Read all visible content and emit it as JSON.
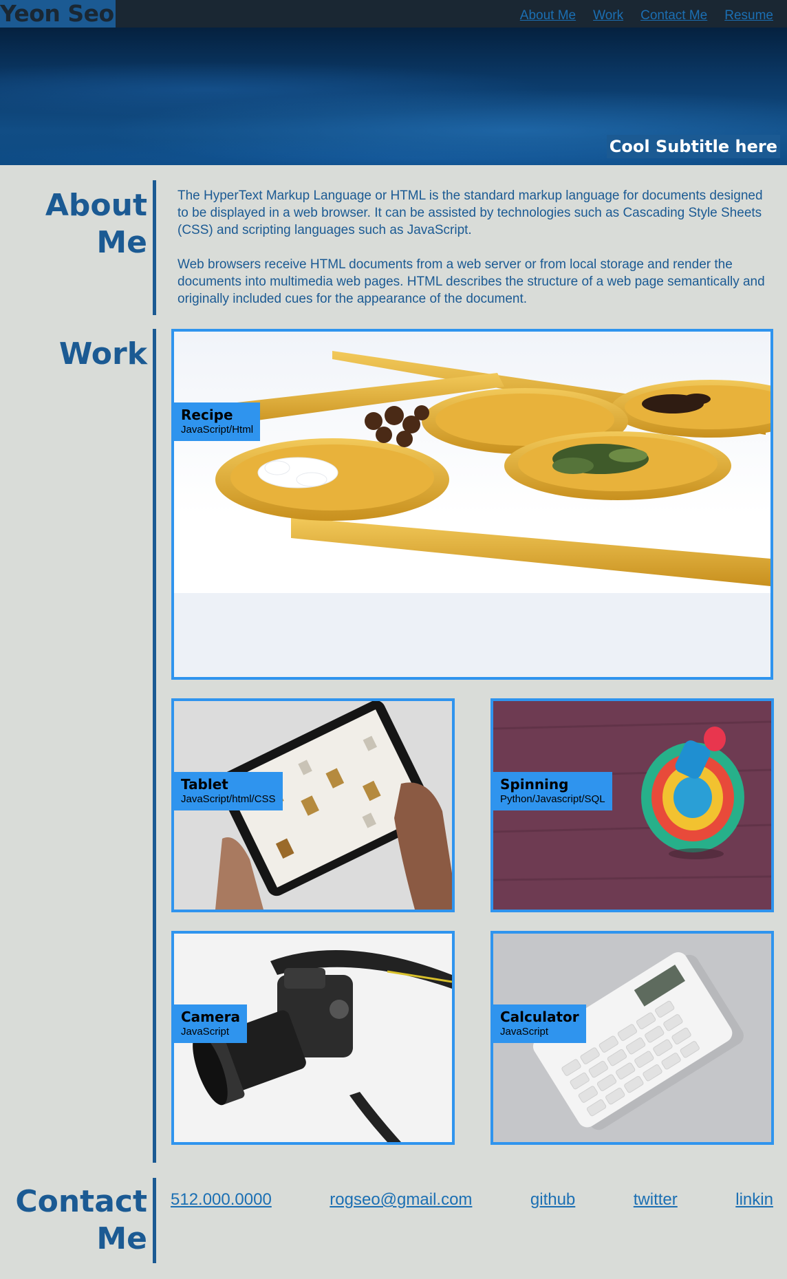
{
  "header": {
    "logo": "Yeon Seo",
    "nav": [
      "About Me",
      "Work",
      "Contact Me",
      "Resume"
    ],
    "subtitle": "Cool Subtitle here"
  },
  "about": {
    "title_line1": "About",
    "title_line2": "Me",
    "paragraphs": [
      "The HyperText Markup Language or HTML is the standard markup language for documents designed to be displayed in a web browser. It can be assisted by technologies such as Cascading Style Sheets (CSS) and scripting languages such as JavaScript.",
      "Web browsers receive HTML documents from a web server or from local storage and render the documents into multimedia web pages. HTML describes the structure of a web page semantically and originally included cues for the appearance of the document."
    ]
  },
  "work": {
    "title": "Work",
    "projects": [
      {
        "title": "Recipe",
        "tech": "JavaScript/Html",
        "image": "wooden-spoons-spices"
      },
      {
        "title": "Tablet",
        "tech": "JavaScript/html/CSS",
        "image": "hands-holding-tablet"
      },
      {
        "title": "Spinning",
        "tech": "Python/Javascript/SQL",
        "image": "spinning-top-toy"
      },
      {
        "title": "Camera",
        "tech": "JavaScript",
        "image": "dslr-camera"
      },
      {
        "title": "Calculator",
        "tech": "JavaScript",
        "image": "white-calculator"
      }
    ]
  },
  "contact": {
    "title_line1": "Contact",
    "title_line2": "Me",
    "links": [
      "512.000.0000",
      "rogseo@gmail.com",
      "github",
      "twitter",
      "linkin"
    ]
  }
}
